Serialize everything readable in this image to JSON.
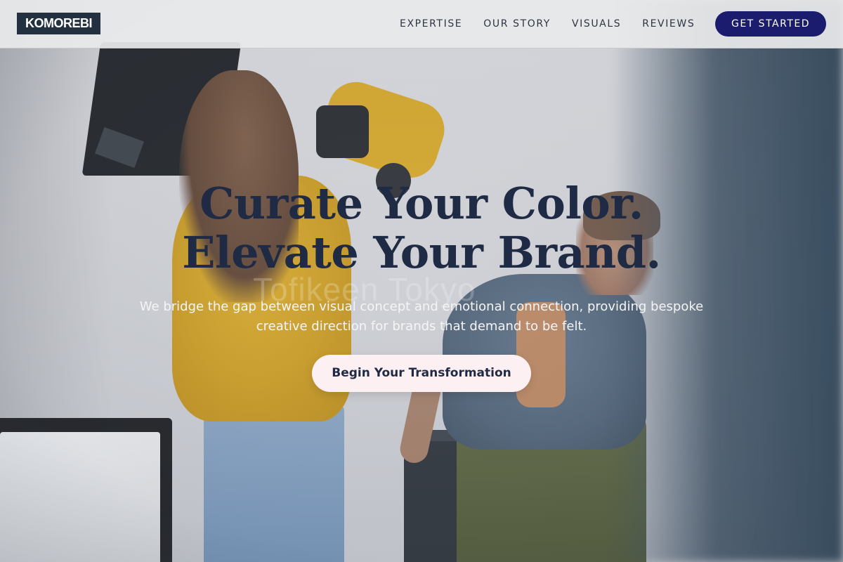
{
  "brand": {
    "logo_text": "KOMOREBI"
  },
  "nav": {
    "links": [
      {
        "label": "EXPERTISE"
      },
      {
        "label": "OUR STORY"
      },
      {
        "label": "VISUALS"
      },
      {
        "label": "REVIEWS"
      }
    ],
    "cta_label": "GET STARTED"
  },
  "hero": {
    "headline_line1": "Curate Your Color.",
    "headline_line2": "Elevate Your Brand.",
    "watermark_text": "Tofikeen Tokyo",
    "subcopy": "We bridge the gap between visual concept and emotional connection, providing bespoke creative direction for brands that demand to be felt.",
    "cta_label": "Begin Your Transformation",
    "image_description_icon": "photo-studio-background"
  },
  "colors": {
    "header_bg": "#e8e9eb",
    "logo_bg": "#22303f",
    "nav_cta_bg": "#1b1c6e",
    "headline": "#1f2a44",
    "hero_cta_bg": "#fdf0f2"
  }
}
